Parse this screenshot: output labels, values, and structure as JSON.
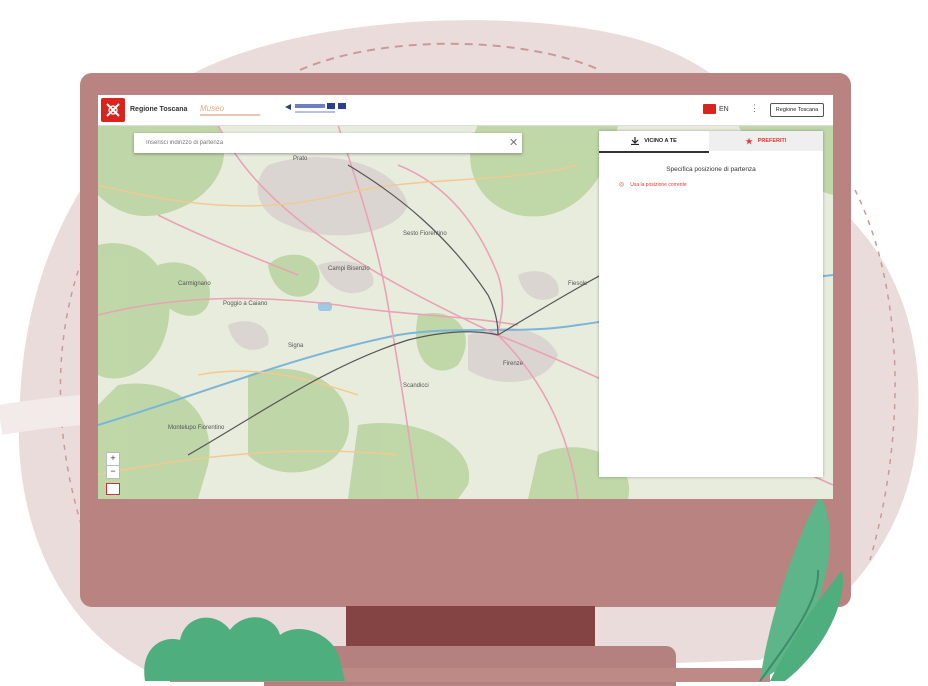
{
  "header": {
    "brand": "Regione Toscana",
    "lang_label": "EN",
    "login_label": "Regione Toscana",
    "menu_icon": "more-vert-icon",
    "flag_icon": "flag-icon"
  },
  "search": {
    "placeholder": "Inserisci indirizzo di partenza",
    "value": ""
  },
  "panel": {
    "tabs": [
      {
        "label": "VICINO A TE",
        "icon": "download-pin-icon"
      },
      {
        "label": "PREFERITI",
        "icon": "star-icon"
      }
    ],
    "heading": "Specifica posizione di partenza",
    "use_position_label": "Usa la posizione corrente"
  },
  "map": {
    "places": [
      "Prato",
      "Campi Bisenzio",
      "Carmignano",
      "Poggio a Caiano",
      "Signa",
      "Firenze",
      "Montelupo Fiorentino",
      "Scandicci",
      "Sesto Fiorentino",
      "Fiesole"
    ]
  },
  "colors": {
    "monitor": "#b98381",
    "stand": "#844444",
    "brand_red": "#d8241c",
    "accent_red": "#e53935",
    "leaf_green": "#5eb58a",
    "bush_green": "#4fae7d"
  }
}
